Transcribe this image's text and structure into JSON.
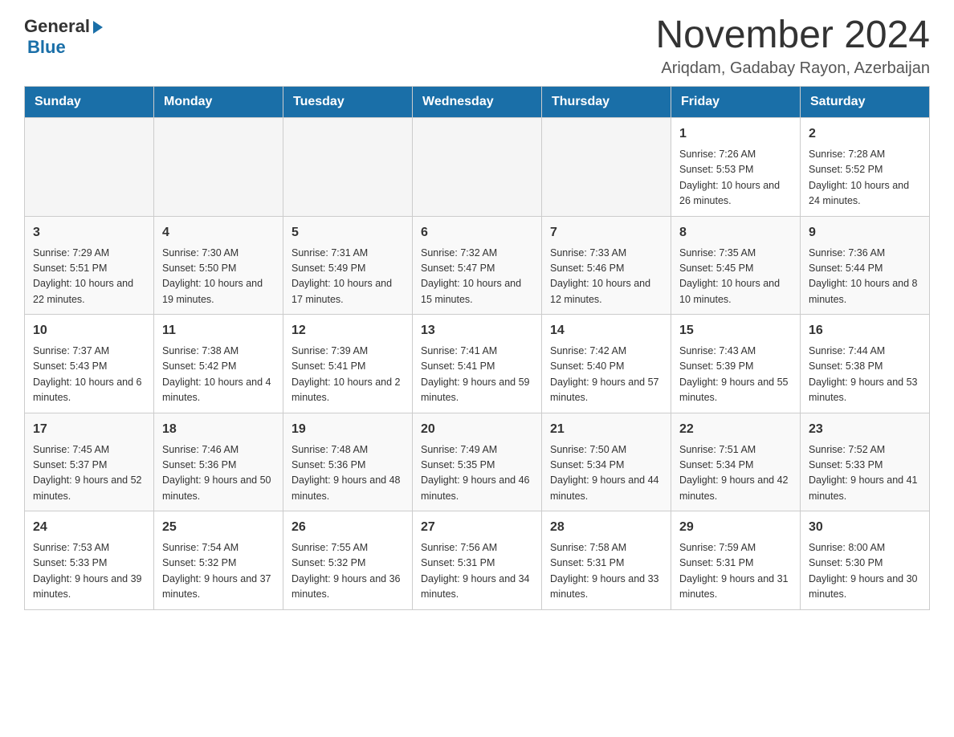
{
  "header": {
    "logo_general": "General",
    "logo_blue": "Blue",
    "month_title": "November 2024",
    "location": "Ariqdam, Gadabay Rayon, Azerbaijan"
  },
  "weekdays": [
    "Sunday",
    "Monday",
    "Tuesday",
    "Wednesday",
    "Thursday",
    "Friday",
    "Saturday"
  ],
  "weeks": [
    [
      {
        "day": "",
        "info": ""
      },
      {
        "day": "",
        "info": ""
      },
      {
        "day": "",
        "info": ""
      },
      {
        "day": "",
        "info": ""
      },
      {
        "day": "",
        "info": ""
      },
      {
        "day": "1",
        "info": "Sunrise: 7:26 AM\nSunset: 5:53 PM\nDaylight: 10 hours and 26 minutes."
      },
      {
        "day": "2",
        "info": "Sunrise: 7:28 AM\nSunset: 5:52 PM\nDaylight: 10 hours and 24 minutes."
      }
    ],
    [
      {
        "day": "3",
        "info": "Sunrise: 7:29 AM\nSunset: 5:51 PM\nDaylight: 10 hours and 22 minutes."
      },
      {
        "day": "4",
        "info": "Sunrise: 7:30 AM\nSunset: 5:50 PM\nDaylight: 10 hours and 19 minutes."
      },
      {
        "day": "5",
        "info": "Sunrise: 7:31 AM\nSunset: 5:49 PM\nDaylight: 10 hours and 17 minutes."
      },
      {
        "day": "6",
        "info": "Sunrise: 7:32 AM\nSunset: 5:47 PM\nDaylight: 10 hours and 15 minutes."
      },
      {
        "day": "7",
        "info": "Sunrise: 7:33 AM\nSunset: 5:46 PM\nDaylight: 10 hours and 12 minutes."
      },
      {
        "day": "8",
        "info": "Sunrise: 7:35 AM\nSunset: 5:45 PM\nDaylight: 10 hours and 10 minutes."
      },
      {
        "day": "9",
        "info": "Sunrise: 7:36 AM\nSunset: 5:44 PM\nDaylight: 10 hours and 8 minutes."
      }
    ],
    [
      {
        "day": "10",
        "info": "Sunrise: 7:37 AM\nSunset: 5:43 PM\nDaylight: 10 hours and 6 minutes."
      },
      {
        "day": "11",
        "info": "Sunrise: 7:38 AM\nSunset: 5:42 PM\nDaylight: 10 hours and 4 minutes."
      },
      {
        "day": "12",
        "info": "Sunrise: 7:39 AM\nSunset: 5:41 PM\nDaylight: 10 hours and 2 minutes."
      },
      {
        "day": "13",
        "info": "Sunrise: 7:41 AM\nSunset: 5:41 PM\nDaylight: 9 hours and 59 minutes."
      },
      {
        "day": "14",
        "info": "Sunrise: 7:42 AM\nSunset: 5:40 PM\nDaylight: 9 hours and 57 minutes."
      },
      {
        "day": "15",
        "info": "Sunrise: 7:43 AM\nSunset: 5:39 PM\nDaylight: 9 hours and 55 minutes."
      },
      {
        "day": "16",
        "info": "Sunrise: 7:44 AM\nSunset: 5:38 PM\nDaylight: 9 hours and 53 minutes."
      }
    ],
    [
      {
        "day": "17",
        "info": "Sunrise: 7:45 AM\nSunset: 5:37 PM\nDaylight: 9 hours and 52 minutes."
      },
      {
        "day": "18",
        "info": "Sunrise: 7:46 AM\nSunset: 5:36 PM\nDaylight: 9 hours and 50 minutes."
      },
      {
        "day": "19",
        "info": "Sunrise: 7:48 AM\nSunset: 5:36 PM\nDaylight: 9 hours and 48 minutes."
      },
      {
        "day": "20",
        "info": "Sunrise: 7:49 AM\nSunset: 5:35 PM\nDaylight: 9 hours and 46 minutes."
      },
      {
        "day": "21",
        "info": "Sunrise: 7:50 AM\nSunset: 5:34 PM\nDaylight: 9 hours and 44 minutes."
      },
      {
        "day": "22",
        "info": "Sunrise: 7:51 AM\nSunset: 5:34 PM\nDaylight: 9 hours and 42 minutes."
      },
      {
        "day": "23",
        "info": "Sunrise: 7:52 AM\nSunset: 5:33 PM\nDaylight: 9 hours and 41 minutes."
      }
    ],
    [
      {
        "day": "24",
        "info": "Sunrise: 7:53 AM\nSunset: 5:33 PM\nDaylight: 9 hours and 39 minutes."
      },
      {
        "day": "25",
        "info": "Sunrise: 7:54 AM\nSunset: 5:32 PM\nDaylight: 9 hours and 37 minutes."
      },
      {
        "day": "26",
        "info": "Sunrise: 7:55 AM\nSunset: 5:32 PM\nDaylight: 9 hours and 36 minutes."
      },
      {
        "day": "27",
        "info": "Sunrise: 7:56 AM\nSunset: 5:31 PM\nDaylight: 9 hours and 34 minutes."
      },
      {
        "day": "28",
        "info": "Sunrise: 7:58 AM\nSunset: 5:31 PM\nDaylight: 9 hours and 33 minutes."
      },
      {
        "day": "29",
        "info": "Sunrise: 7:59 AM\nSunset: 5:31 PM\nDaylight: 9 hours and 31 minutes."
      },
      {
        "day": "30",
        "info": "Sunrise: 8:00 AM\nSunset: 5:30 PM\nDaylight: 9 hours and 30 minutes."
      }
    ]
  ]
}
